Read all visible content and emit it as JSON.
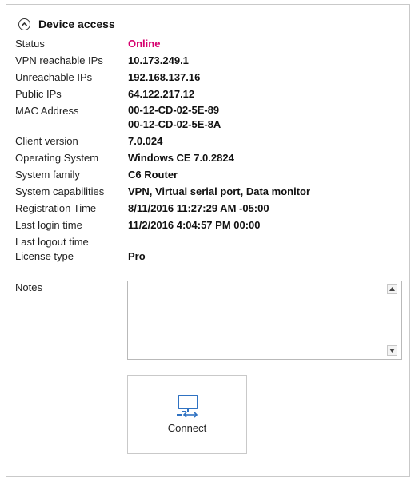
{
  "section": {
    "title": "Device access",
    "collapse_icon": "chevron-up-circle-icon"
  },
  "fields": {
    "status": {
      "label": "Status",
      "value": "Online",
      "color": "#d6006e"
    },
    "vpn_reachable_ips": {
      "label": "VPN reachable IPs",
      "value": "10.173.249.1"
    },
    "unreachable_ips": {
      "label": "Unreachable IPs",
      "value": "192.168.137.16"
    },
    "public_ips": {
      "label": "Public IPs",
      "value": "64.122.217.12"
    },
    "mac_address": {
      "label": "MAC Address",
      "values": [
        "00-12-CD-02-5E-89",
        "00-12-CD-02-5E-8A"
      ]
    },
    "client_version": {
      "label": "Client version",
      "value": "7.0.024"
    },
    "operating_system": {
      "label": "Operating System",
      "value": "Windows CE 7.0.2824"
    },
    "system_family": {
      "label": "System family",
      "value": "C6 Router"
    },
    "system_capabilities": {
      "label": "System capabilities",
      "value": "VPN, Virtual serial port, Data monitor"
    },
    "registration_time": {
      "label": "Registration Time",
      "value": "8/11/2016 11:27:29 AM -05:00"
    },
    "last_login_time": {
      "label": "Last login time",
      "value": "11/2/2016 4:04:57 PM 00:00"
    },
    "last_logout_time": {
      "label": "Last logout time",
      "value": ""
    },
    "license_type": {
      "label": "License type",
      "value": "Pro"
    }
  },
  "notes": {
    "label": "Notes",
    "value": ""
  },
  "connect": {
    "label": "Connect",
    "icon": "remote-desktop-connect-icon",
    "accent": "#2f72c2"
  }
}
